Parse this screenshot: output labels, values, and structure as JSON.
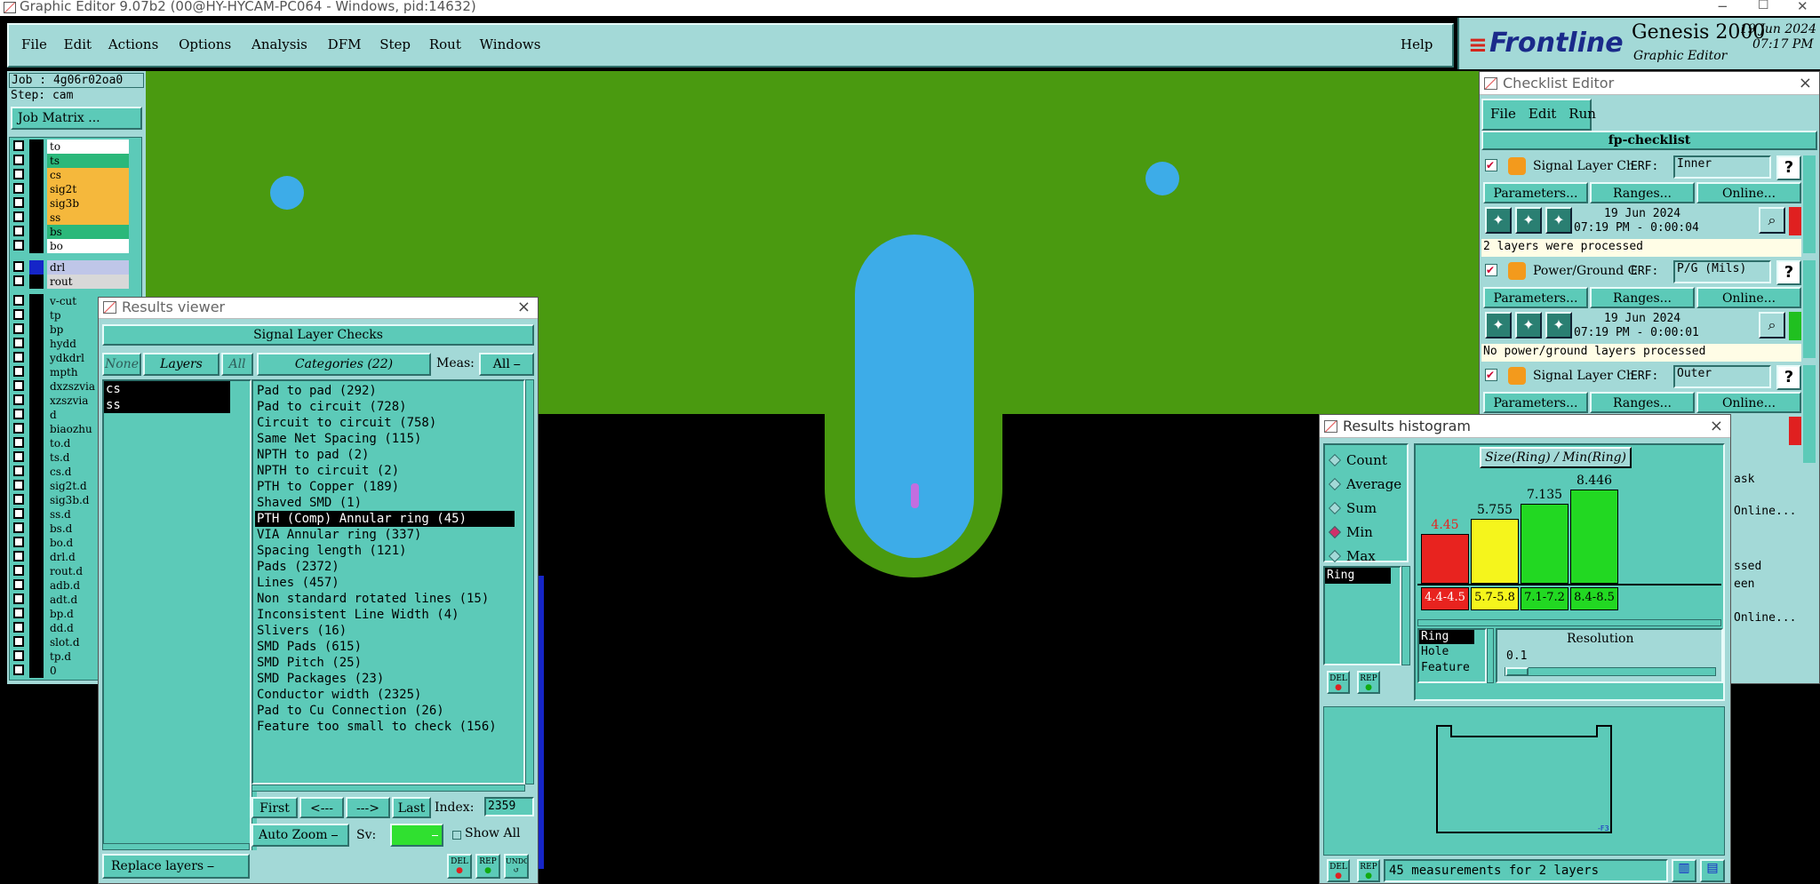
{
  "title_bar": {
    "title": "Graphic Editor 9.07b2 (00@HY-HYCAM-PC064 - Windows, pid:14632)",
    "minimize": "−",
    "maximize": "☐",
    "close": "✕"
  },
  "menu": {
    "items": [
      "File",
      "Edit",
      "Actions",
      "Options",
      "Analysis",
      "DFM",
      "Step",
      "Rout",
      "Windows"
    ],
    "help": "Help"
  },
  "brand": {
    "logo": "Frontline",
    "product": "Genesis 2000",
    "subtitle": "Graphic Editor",
    "date": "19 Jun 2024",
    "time": "07:17 PM"
  },
  "job": {
    "job_line": "Job : 4g06r02oa0",
    "step_line": "Step: cam",
    "matrix_button": "Job Matrix ..."
  },
  "layers": [
    {
      "name": "to",
      "color": "#ffffff"
    },
    {
      "name": "ts",
      "color": "#2bb87a"
    },
    {
      "name": "cs",
      "color": "#f5b83c"
    },
    {
      "name": "sig2t",
      "color": "#f5b83c"
    },
    {
      "name": "sig3b",
      "color": "#f5b83c"
    },
    {
      "name": "ss",
      "color": "#f5b83c"
    },
    {
      "name": "bs",
      "color": "#2bb87a"
    },
    {
      "name": "bo",
      "color": "#ffffff"
    },
    {
      "name": "drl",
      "color": "#bfc6e8"
    },
    {
      "name": "rout",
      "color": "#d8d8d8"
    },
    {
      "name": "v-cut"
    },
    {
      "name": "tp"
    },
    {
      "name": "bp"
    },
    {
      "name": "hydd"
    },
    {
      "name": "ydkdrl"
    },
    {
      "name": "mpth"
    },
    {
      "name": "dxzszvia"
    },
    {
      "name": "xzszvia"
    },
    {
      "name": "d"
    },
    {
      "name": "biaozhu"
    },
    {
      "name": "to.d"
    },
    {
      "name": "ts.d"
    },
    {
      "name": "cs.d"
    },
    {
      "name": "sig2t.d"
    },
    {
      "name": "sig3b.d"
    },
    {
      "name": "ss.d"
    },
    {
      "name": "bs.d"
    },
    {
      "name": "bo.d"
    },
    {
      "name": "drl.d"
    },
    {
      "name": "rout.d"
    },
    {
      "name": "adb.d"
    },
    {
      "name": "adt.d"
    },
    {
      "name": "bp.d"
    },
    {
      "name": "dd.d"
    },
    {
      "name": "slot.d"
    },
    {
      "name": "tp.d"
    },
    {
      "name": "0"
    }
  ],
  "results_viewer": {
    "title": "Results viewer",
    "banner": "Signal Layer Checks",
    "none": "None",
    "layers_label": "Layers",
    "all": "All",
    "categories_label": "Categories (22)",
    "meas_label": "Meas:",
    "meas_value": "All",
    "layer_list": [
      "cs",
      "ss"
    ],
    "categories": [
      "Pad to pad (292)",
      "Pad to circuit (728)",
      "Circuit to circuit (758)",
      "Same Net Spacing (115)",
      "NPTH to pad (2)",
      "NPTH to circuit (2)",
      "PTH to Copper (189)",
      "Shaved SMD (1)",
      "PTH (Comp) Annular ring (45)",
      "VIA Annular ring (337)",
      "Spacing length (121)",
      "Pads (2372)",
      "Lines (457)",
      "Non standard rotated lines (15)",
      "Inconsistent Line Width (4)",
      "Slivers (16)",
      "SMD Pads (615)",
      "SMD Pitch (25)",
      "SMD Packages (23)",
      "Conductor width (2325)",
      "Pad to Cu Connection (26)",
      "Feature too small to check (156)"
    ],
    "selected_category": 8,
    "nav": {
      "first": "First",
      "prev": "<---",
      "next": "--->",
      "last": "Last",
      "index_label": "Index:",
      "index_value": "2359"
    },
    "auto_zoom": "Auto Zoom",
    "sv_label": "Sv:",
    "show_all": "Show All",
    "replace_layers": "Replace layers",
    "btn_del": "DEL",
    "btn_rep": "REP",
    "btn_undo": "UNDO"
  },
  "checklist": {
    "title": "Checklist Editor",
    "menu": [
      "File",
      "Edit",
      "Run"
    ],
    "name": "fp-checklist",
    "items": [
      {
        "name": "Signal Layer Ch",
        "erf": "ERF:",
        "erf_value": "Inner",
        "date": "19 Jun 2024",
        "time": "07:19 PM - 0:00:04",
        "status": "2 layers were processed",
        "flag": "#e02020"
      },
      {
        "name": "Power/Ground C",
        "erf": "ERF:",
        "erf_value": "P/G (Mils)",
        "date": "19 Jun 2024",
        "time": "07:19 PM - 0:00:01",
        "status": "No power/ground layers processed",
        "flag": "#20c020"
      },
      {
        "name": "Signal Layer Ch",
        "erf": "ERF:",
        "erf_value": "Outer",
        "flag": "#e02020"
      }
    ],
    "buttons": {
      "parameters": "Parameters...",
      "ranges": "Ranges...",
      "online": "Online..."
    },
    "partial": [
      "ask",
      "Online...",
      "ssed",
      "een",
      "Online..."
    ]
  },
  "histogram": {
    "title": "Results histogram",
    "modes": [
      "Count",
      "Average",
      "Sum",
      "Min",
      "Max"
    ],
    "selected_mode": "Min",
    "heading": "Size(Ring) / Min(Ring)",
    "left_list": [
      "Ring"
    ],
    "bottom_list": [
      "Ring",
      "Hole",
      "Feature"
    ],
    "resolution_label": "Resolution",
    "resolution_value": "0.1",
    "status": "45 measurements for 2 layers",
    "scale_tick": "-F3",
    "btn_del": "DEL",
    "btn_rep": "REP"
  },
  "chart_data": {
    "type": "bar",
    "title": "Size(Ring) / Min(Ring)",
    "categories": [
      "4.4-4.5",
      "5.7-5.8",
      "7.1-7.2",
      "8.4-8.5"
    ],
    "values": [
      4.45,
      5.755,
      7.135,
      8.446
    ],
    "value_labels": [
      "4.45",
      "5.755",
      "7.135",
      "8.446"
    ],
    "colors": [
      "#e8231f",
      "#f5f51c",
      "#22d822",
      "#22d822"
    ]
  }
}
